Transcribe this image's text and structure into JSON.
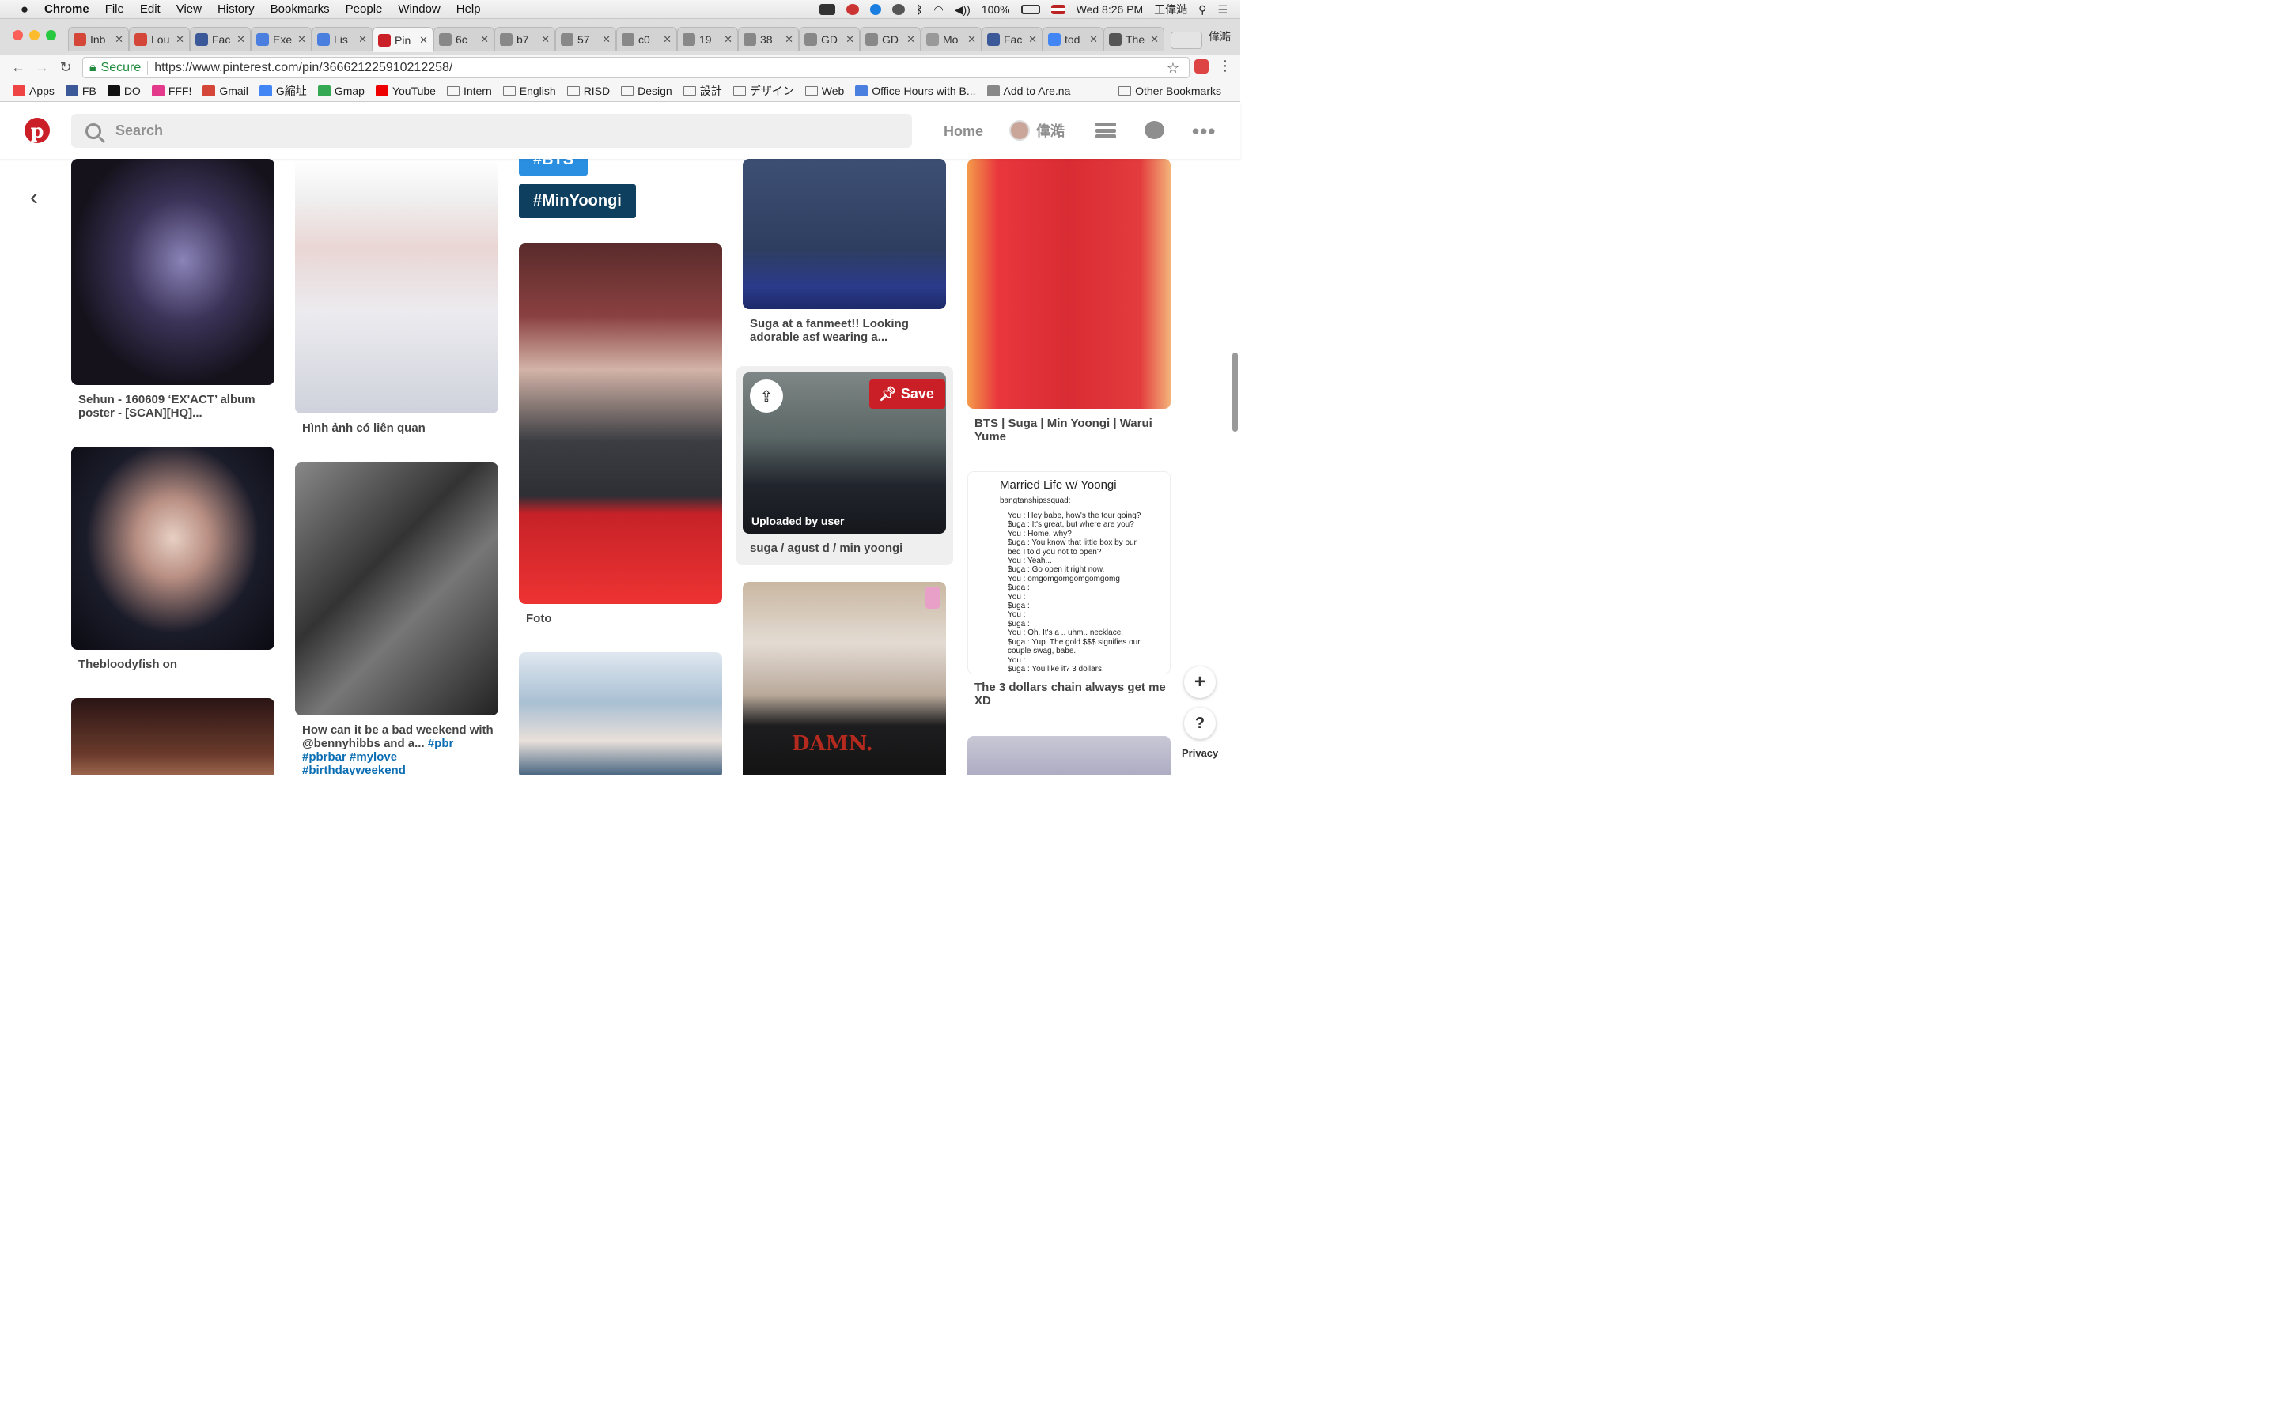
{
  "menubar": {
    "app": "Chrome",
    "items": [
      "File",
      "Edit",
      "View",
      "History",
      "Bookmarks",
      "People",
      "Window",
      "Help"
    ],
    "battery": "100%",
    "datetime": "Wed 8:26 PM",
    "user": "王偉澔"
  },
  "tabs": [
    {
      "label": "Inb",
      "icon": "gmail-icon",
      "color": "#d44638"
    },
    {
      "label": "Lou",
      "icon": "gmail-icon",
      "color": "#d44638"
    },
    {
      "label": "Fac",
      "icon": "facebook-icon",
      "color": "#3b5998"
    },
    {
      "label": "Exe",
      "icon": "docs-icon",
      "color": "#4a7fe0"
    },
    {
      "label": "Lis",
      "icon": "docs-icon",
      "color": "#4a7fe0"
    },
    {
      "label": "Pin",
      "icon": "pinterest-icon",
      "color": "#cb1f27",
      "active": true
    },
    {
      "label": "6c",
      "icon": "file-icon",
      "color": "#888"
    },
    {
      "label": "b7",
      "icon": "file-icon",
      "color": "#888"
    },
    {
      "label": "57",
      "icon": "file-icon",
      "color": "#888"
    },
    {
      "label": "c0",
      "icon": "file-icon",
      "color": "#888"
    },
    {
      "label": "19",
      "icon": "file-icon",
      "color": "#888"
    },
    {
      "label": "38",
      "icon": "file-icon",
      "color": "#888"
    },
    {
      "label": "GD",
      "icon": "file-icon",
      "color": "#888"
    },
    {
      "label": "GD",
      "icon": "file-icon",
      "color": "#888"
    },
    {
      "label": "Mo",
      "icon": "photo-icon",
      "color": "#999"
    },
    {
      "label": "Fac",
      "icon": "facebook-icon",
      "color": "#3b5998"
    },
    {
      "label": "tod",
      "icon": "google-icon",
      "color": "#4285f4"
    },
    {
      "label": "The",
      "icon": "wikipedia-icon",
      "color": "#555"
    }
  ],
  "profile_name": "偉澔",
  "url": {
    "secure_label": "Secure",
    "address": "https://www.pinterest.com/pin/366621225910212258/"
  },
  "bookmarks": [
    {
      "label": "Apps",
      "icon": "apps-icon",
      "color": "#e44"
    },
    {
      "label": "FB",
      "icon": "facebook-icon",
      "color": "#3b5998"
    },
    {
      "label": "DO",
      "icon": "do-icon",
      "color": "#111"
    },
    {
      "label": "FFF!",
      "icon": "heart-icon",
      "color": "#e33a8c"
    },
    {
      "label": "Gmail",
      "icon": "gmail-icon",
      "color": "#d44638"
    },
    {
      "label": "G縮址",
      "icon": "google-icon",
      "color": "#4285f4"
    },
    {
      "label": "Gmap",
      "icon": "maps-icon",
      "color": "#34a853"
    },
    {
      "label": "YouTube",
      "icon": "youtube-icon",
      "color": "#e00"
    },
    {
      "label": "Intern",
      "icon": "folder-icon"
    },
    {
      "label": "English",
      "icon": "folder-icon"
    },
    {
      "label": "RISD",
      "icon": "folder-icon"
    },
    {
      "label": "Design",
      "icon": "folder-icon"
    },
    {
      "label": "設計",
      "icon": "folder-icon"
    },
    {
      "label": "デザイン",
      "icon": "folder-icon"
    },
    {
      "label": "Web",
      "icon": "folder-icon"
    },
    {
      "label": "Office Hours with B...",
      "icon": "docs-icon",
      "color": "#4a7fe0"
    },
    {
      "label": "Add to Are.na",
      "icon": "file-icon",
      "color": "#888"
    }
  ],
  "other_bookmarks": "Other Bookmarks",
  "pinterest": {
    "search_placeholder": "Search",
    "home": "Home",
    "username": "偉澔",
    "brand_color": "#cb1f27"
  },
  "tags": {
    "top": "#BTS",
    "main": "#MinYoongi"
  },
  "pins": {
    "p1": "Sehun - 160609 ‘EX'ACT’ album poster - [SCAN][HQ]...",
    "p2": "Thebloodyfish on",
    "p3": "Hình ảnh có liên quan",
    "p4_plain": "How can it be a bad weekend with @bennyhibbs and a... ",
    "p4_tags": "#pbr #pbrbar #mylove #birthdayweekend",
    "p5": "Foto",
    "p6": "Suga at a fanmeet!! Looking adorable asf wearing a...",
    "p7": "suga / agust d / min yoongi",
    "p8": "BTS | Suga | Min Yoongi | Warui Yume",
    "p9": "The 3 dollars chain always get me XD"
  },
  "hover": {
    "save": "Save",
    "uploaded": "Uploaded by user"
  },
  "textpin": {
    "title": "Married Life w/ Yoongi",
    "author": "bangtanshipssquad:",
    "lines": [
      "You : Hey babe, how's the tour going?",
      "$uga : It's great, but where are you?",
      "You : Home, why?",
      "$uga : You know that little box by our",
      "bed I told you not to open?",
      "You : Yeah...",
      "$uga : Go open it right now.",
      "You : omgomgomgomgomgomg",
      "$uga :",
      "You :",
      "$uga :",
      "You :",
      "$uga :",
      "You : Oh. It's a .. uhm.. necklace.",
      "$uga : Yup. The gold $$$ signifies our",
      "couple swag, babe.",
      "You :",
      "$uga : You like it? 3 dollars."
    ]
  },
  "image_labels": {
    "damn": "DAMN."
  },
  "privacy": "Privacy"
}
